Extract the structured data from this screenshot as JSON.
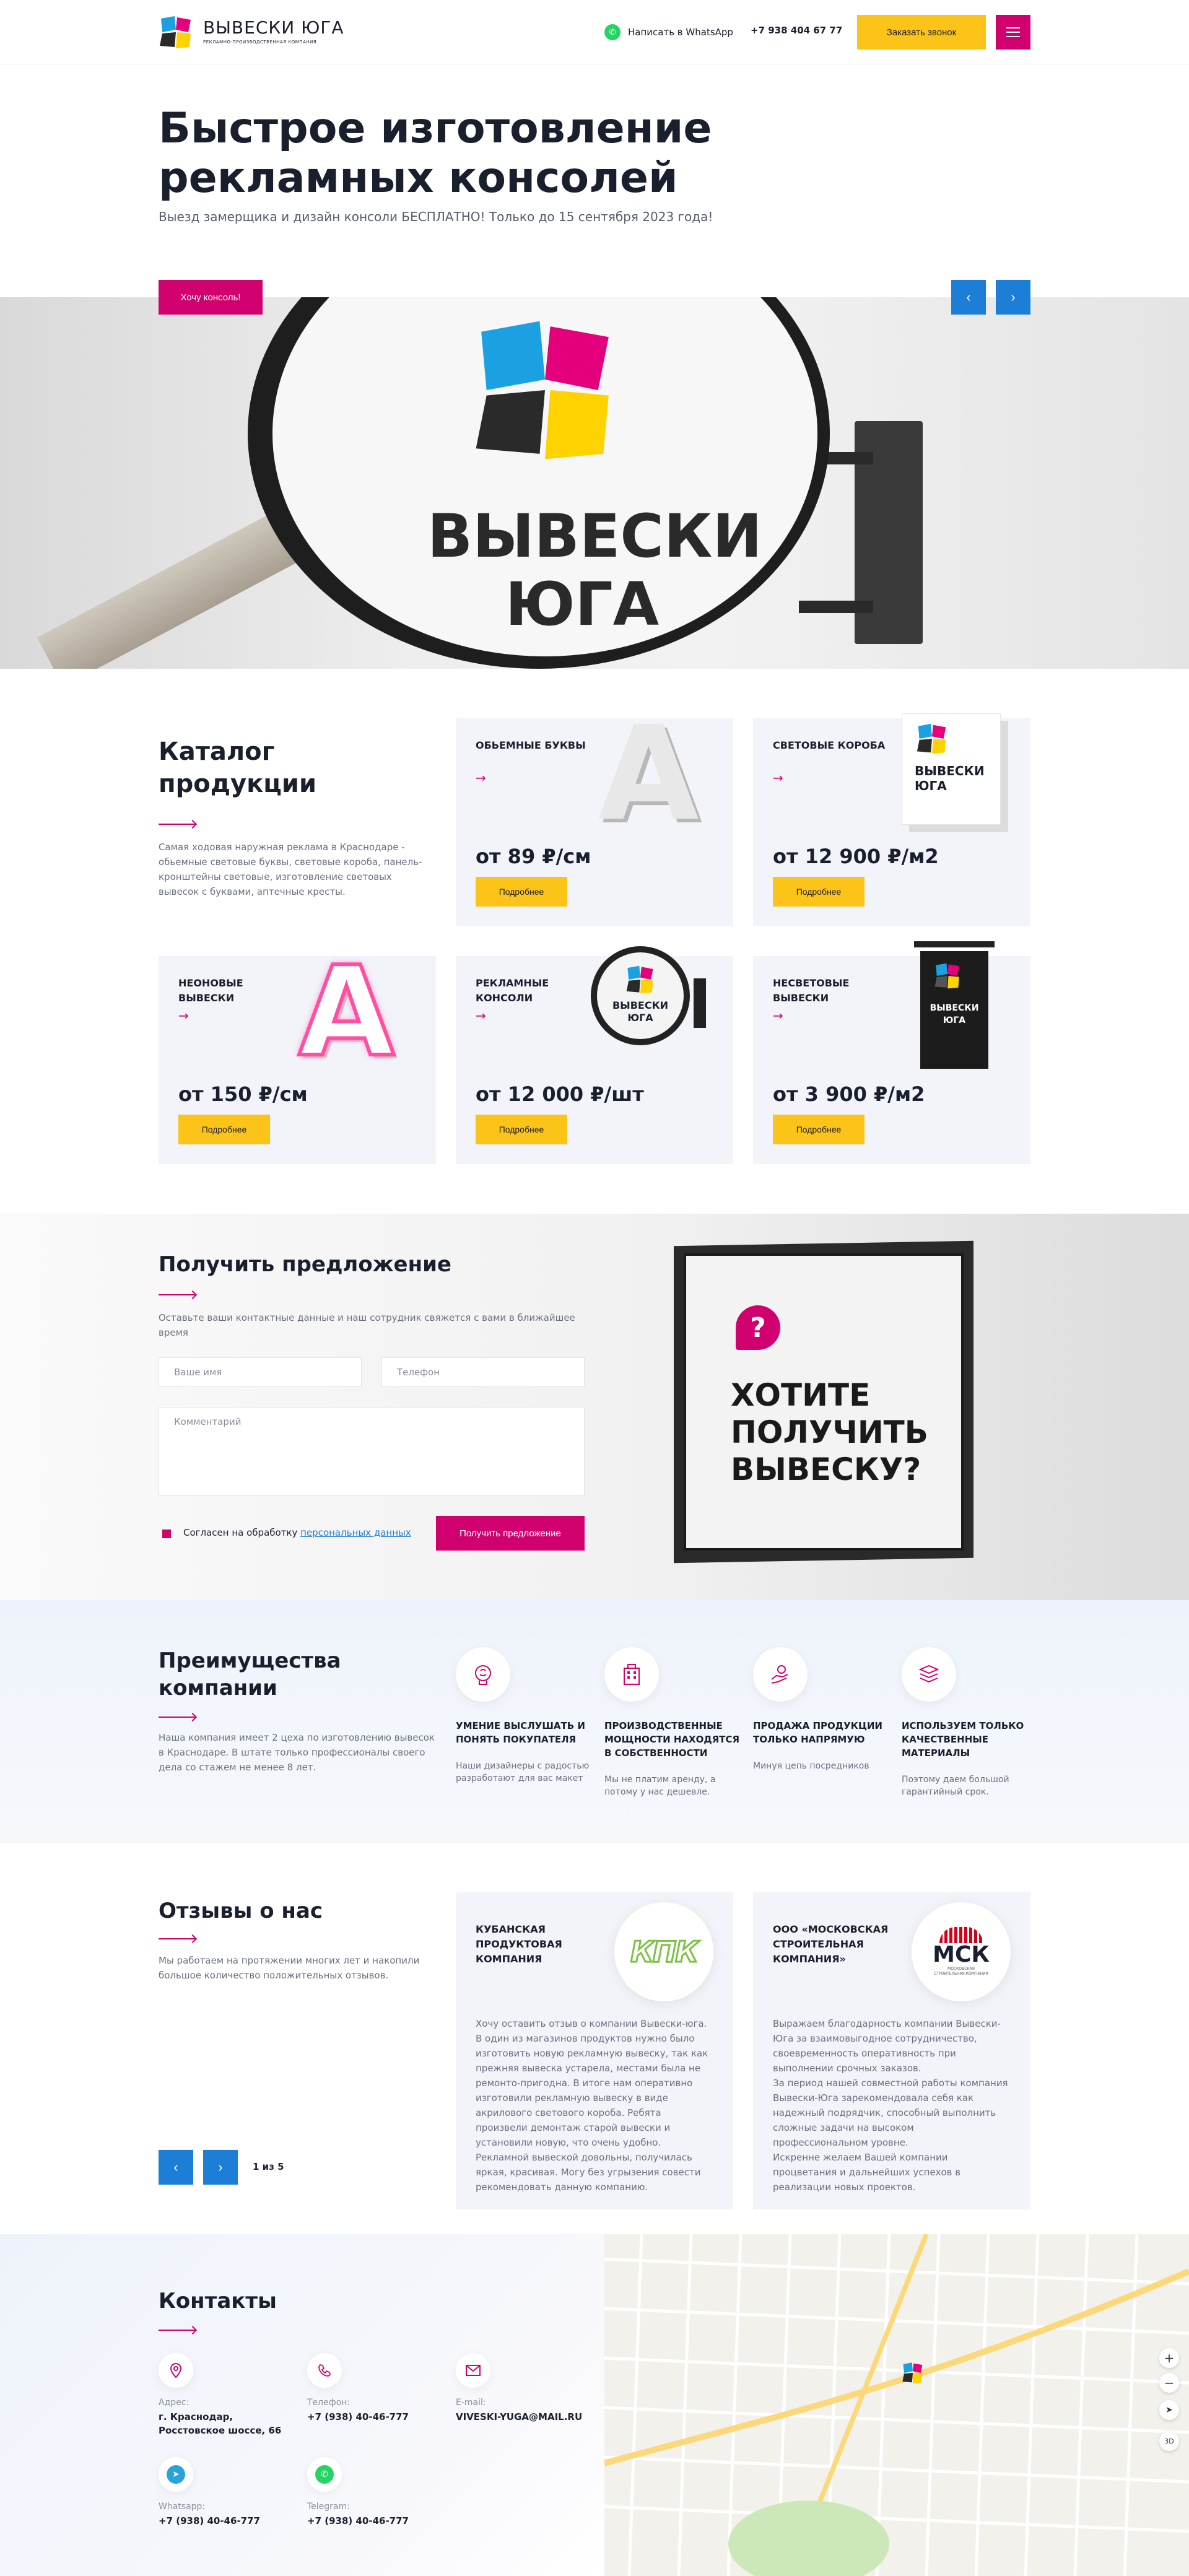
{
  "header": {
    "logo_text": "ВЫВЕСКИ ЮГА",
    "logo_sub": "РЕКЛАМНО-ПРОИЗВОДСТВЕННАЯ КОМПАНИЯ",
    "whatsapp_label": "Написать в WhatsApp",
    "phone": "+7 938 404 67 77",
    "call_button": "Заказать звонок"
  },
  "hero": {
    "title_line1": "Быстрое изготовление",
    "title_line2": "рекламных консолей",
    "subtitle": "Выезд замерщика и дизайн консоли БЕСПЛАТНО! Только до 15 сентября 2023 года!",
    "button": "Хочу консоль!",
    "banner_line1": "ВЫВЕСКИ",
    "banner_line2": "ЮГА"
  },
  "catalog": {
    "title_line1": "Каталог",
    "title_line2": "продукции",
    "description": "Самая ходовая наружная реклама в Краснодаре - обьемные световые буквы, световые короба, панель-кронштейны световые, изготовление световых вывесок с буквами, аптечные кресты.",
    "more_label": "Подробнее",
    "items": [
      {
        "name": "ОБЬЕМНЫЕ БУКВЫ",
        "price": "от 89 ₽/см"
      },
      {
        "name": "СВЕТОВЫЕ КОРОБА",
        "price": "от 12 900 ₽/м2"
      },
      {
        "name": "НЕОНОВЫЕ ВЫВЕСКИ",
        "price": "от 150 ₽/см"
      },
      {
        "name": "РЕКЛАМНЫЕ КОНСОЛИ",
        "price": "от 12 000 ₽/шт"
      },
      {
        "name": "НЕСВЕТОВЫЕ ВЫВЕСКИ",
        "price": "от 3 900 ₽/м2"
      }
    ],
    "sign_line1": "ВЫВЕСКИ",
    "sign_line2": "ЮГА"
  },
  "offer": {
    "title": "Получить предложение",
    "description": "Оставьте ваши контактные данные и наш сотрудник свяжется с вами в ближайшее время",
    "name_placeholder": "Ваше имя",
    "phone_placeholder": "Телефон",
    "comment_placeholder": "Комментарий",
    "consent_prefix": "Согласен на обработку ",
    "consent_link": "персональных данных",
    "submit": "Получить предложение",
    "sign_line1": "ХОТИТЕ",
    "sign_line2": "ПОЛУЧИТЬ",
    "sign_line3": "ВЫВЕСКУ?"
  },
  "advantages": {
    "title_line1": "Преимущества",
    "title_line2": "компании",
    "description": "Наша компания имеет 2 цеха по изготовлению вывесок в Краснодаре. В штате только профессионалы своего дела со стажем не менее 8 лет.",
    "items": [
      {
        "title": "Умение выслушать и понять покупателя",
        "text": "Наши дизайнеры с радостью разработают для вас макет"
      },
      {
        "title": "Производственные мощности находятся в собственности",
        "text": "Мы не платим аренду, а потому у нас дешевле."
      },
      {
        "title": "Продажа продукции только напрямую",
        "text": "Минуя цепь посредников"
      },
      {
        "title": "Используем только качественные материалы",
        "text": "Поэтому даем большой гарантийный срок."
      }
    ]
  },
  "reviews": {
    "title": "Отзывы о нас",
    "description": "Мы работаем на протяжении многих лет и накопили большое количество положительных отзывов.",
    "pager": "1 из 5",
    "items": [
      {
        "company": "Кубанская продуктовая компания",
        "logo_text": "КПК",
        "text": "Хочу оставить отзыв о компании Вывески-юга. В один из магазинов продуктов нужно было изготовить новую рекламную вывеску, так как прежняя вывеска устарела, местами была не ремонто-пригодна. В итоге нам оперативно изготовили рекламную вывеску в виде акрилового светового короба. Ребята произвели демонтаж старой вывески и установили новую, что очень удобно.\nРекламной вывеской довольны, получилась яркая, красивая.  Могу без угрызения совести рекомендовать данную компанию."
      },
      {
        "company": "ООО «Московская строительная компания»",
        "logo_text": "МСК",
        "logo_sub": "МОСКОВСКАЯ СТРОИТЕЛЬНАЯ КОМПАНИЯ",
        "text": "Выражаем благодарность компании Вывески-Юга за взаимовыгодное сотрудничество, своевременность оперативность при выполнении срочных заказов.\nЗа период нашей совместной работы компания Вывески-Юга зарекомендовала себя как надежный подрядчик, способный выполнить сложные задачи на высоком профессиональном уровне.\nИскренне желаем Вашей компании процветания и дальнейших успехов в реализации новых проектов."
      }
    ]
  },
  "contacts": {
    "title": "Контакты",
    "address_label": "Адрес:",
    "address_value": "г. Краснодар,\nРосстовское шоссе, 66",
    "phone_label": "Телефон:",
    "phone_value": "+7 (938) 40-46-777",
    "email_label": "E-mail:",
    "email_value": "VIVESKI-YUGA@MAIL.RU",
    "whatsapp_label": "Whatsapp:",
    "whatsapp_value": "+7 (938) 40-46-777",
    "telegram_label": "Telegram:",
    "telegram_value": "+7 (938) 40-46-777"
  },
  "colors": {
    "magenta": "#d1006f",
    "yellow": "#fcc419",
    "blue": "#1c7ed6",
    "dark": "#1a1f2e"
  }
}
